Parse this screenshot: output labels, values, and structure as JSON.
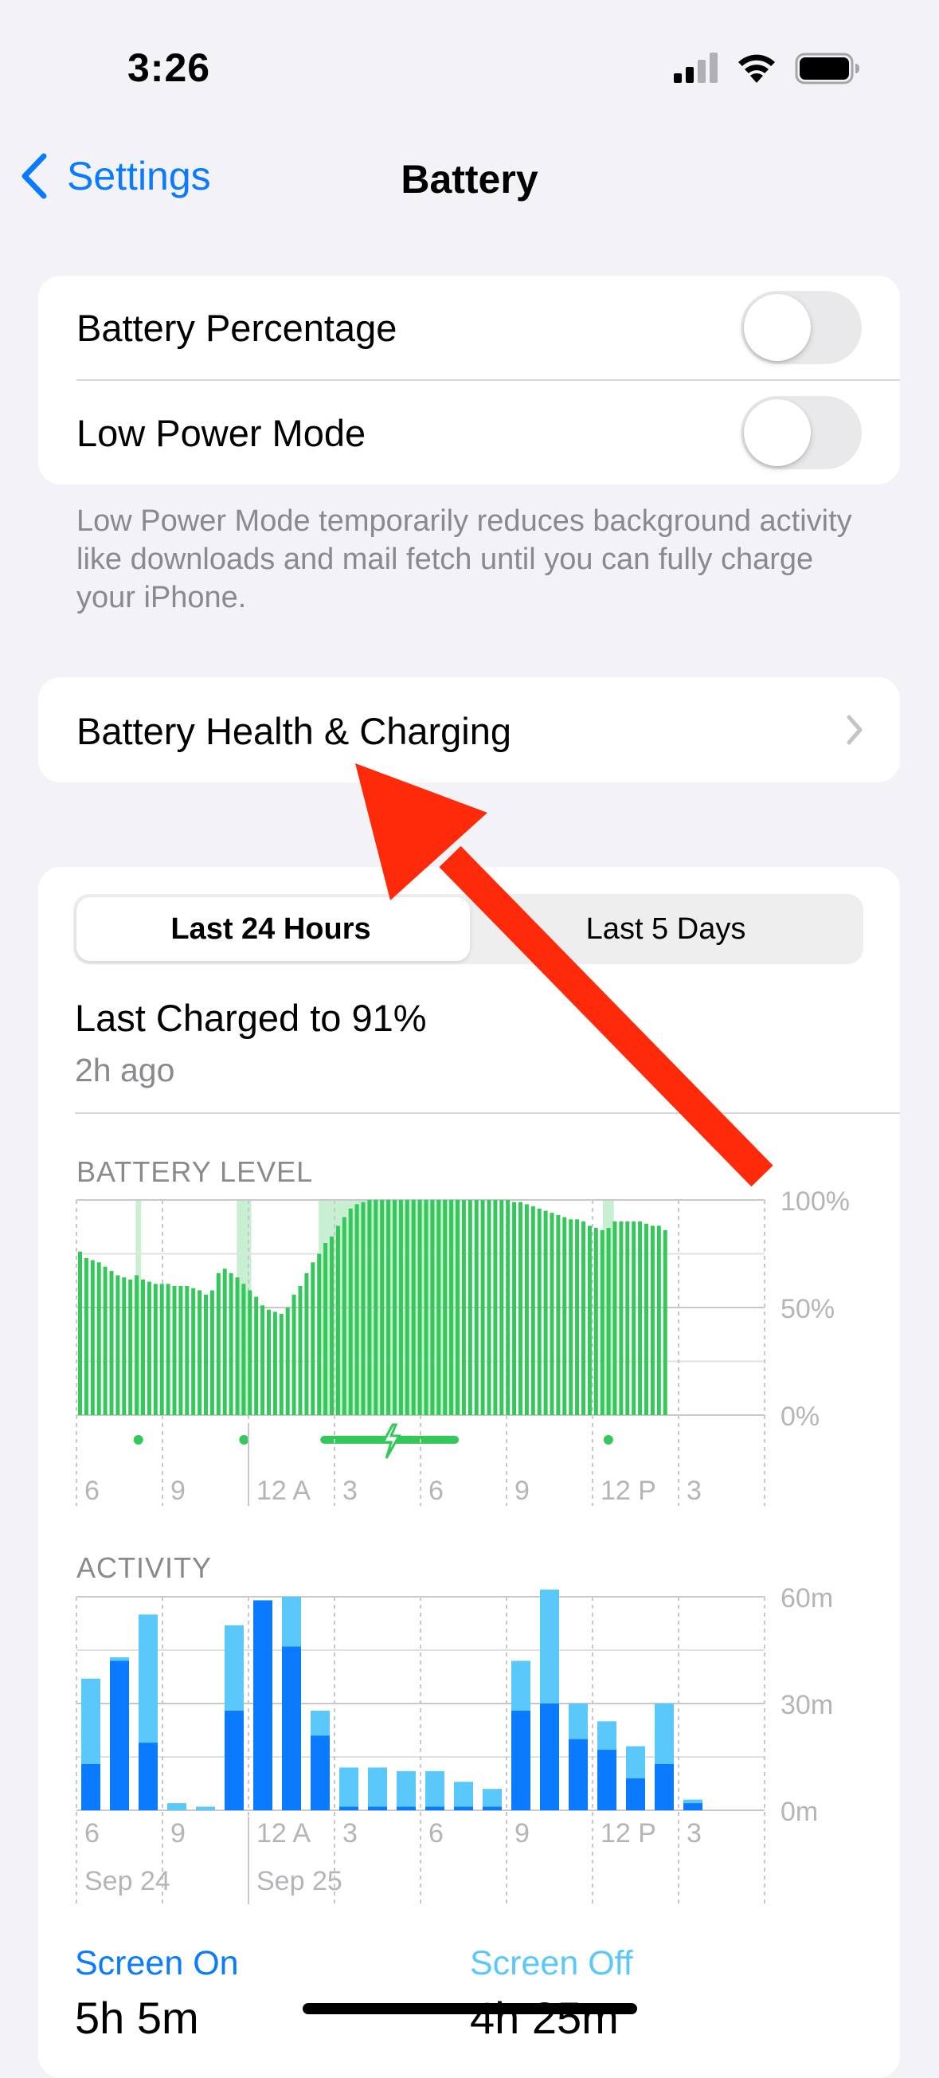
{
  "status_bar": {
    "time": "3:26"
  },
  "nav": {
    "back_label": "Settings",
    "title": "Battery"
  },
  "settings": {
    "battery_percentage": {
      "label": "Battery Percentage",
      "enabled": false
    },
    "low_power_mode": {
      "label": "Low Power Mode",
      "enabled": false
    },
    "footnote": "Low Power Mode temporarily reduces background activity like downloads and mail fetch until you can fully charge your iPhone."
  },
  "health": {
    "label": "Battery Health & Charging"
  },
  "usage": {
    "tabs": [
      "Last 24 Hours",
      "Last 5 Days"
    ],
    "selected_tab": "Last 24 Hours",
    "last_charged": "Last Charged to 91%",
    "last_charged_ago": "2h ago",
    "battery_level_label": "BATTERY LEVEL",
    "activity_label": "ACTIVITY",
    "screen_on_label": "Screen On",
    "screen_on_value": "5h 5m",
    "screen_off_label": "Screen Off",
    "screen_off_value": "4h 25m"
  },
  "colors": {
    "accent": "#0a7aff",
    "battery_green": "#34c759",
    "charging_green": "#c9efd2",
    "screen_on": "#0a7aff",
    "screen_off": "#5ac8fa",
    "annotation_arrow": "#ff2a0a"
  },
  "chart_data": [
    {
      "type": "bar",
      "title": "BATTERY LEVEL",
      "x_tick_labels": [
        "6",
        "9",
        "12 A",
        "3",
        "6",
        "9",
        "12 P",
        "3"
      ],
      "y_tick_labels": [
        "100%",
        "50%",
        "0%"
      ],
      "ylim": [
        0,
        100
      ],
      "values": [
        76,
        73,
        72,
        71,
        69,
        67,
        65,
        64,
        63,
        65,
        63,
        62,
        61,
        61,
        61,
        60,
        60,
        60,
        59,
        58,
        56,
        58,
        66,
        68,
        66,
        64,
        61,
        58,
        55,
        51,
        49,
        48,
        47,
        50,
        56,
        60,
        66,
        71,
        75,
        80,
        83,
        88,
        92,
        96,
        98,
        99,
        100,
        100,
        100,
        100,
        100,
        100,
        100,
        100,
        100,
        100,
        100,
        100,
        100,
        100,
        100,
        100,
        100,
        100,
        100,
        100,
        100,
        100,
        100,
        99,
        99,
        98,
        97,
        96,
        95,
        94,
        93,
        92,
        91,
        91,
        90,
        88,
        87,
        86,
        87,
        90,
        90,
        90,
        90,
        90,
        89,
        88,
        88,
        86
      ],
      "charging_periods_fraction": [
        [
          0.086,
          0.094
        ],
        [
          0.233,
          0.254
        ],
        [
          0.352,
          0.558
        ],
        [
          0.765,
          0.781
        ]
      ]
    },
    {
      "type": "bar",
      "title": "ACTIVITY",
      "x_tick_labels": [
        "6",
        "9",
        "12 A",
        "3",
        "6",
        "9",
        "12 P",
        "3"
      ],
      "date_labels": [
        "Sep 24",
        "Sep 25"
      ],
      "y_tick_labels": [
        "60m",
        "30m",
        "0m"
      ],
      "ylim": [
        0,
        60
      ],
      "series": [
        {
          "name": "Screen On",
          "values": [
            13,
            42,
            19,
            0,
            0,
            28,
            59,
            46,
            21,
            1,
            1,
            1,
            1,
            1,
            1,
            28,
            30,
            20,
            17,
            9,
            13,
            2
          ]
        },
        {
          "name": "Screen Off",
          "values": [
            24,
            1,
            36,
            2,
            1,
            24,
            0,
            14,
            7,
            11,
            11,
            10,
            10,
            7,
            5,
            14,
            32,
            10,
            8,
            9,
            17,
            1
          ]
        }
      ]
    }
  ]
}
